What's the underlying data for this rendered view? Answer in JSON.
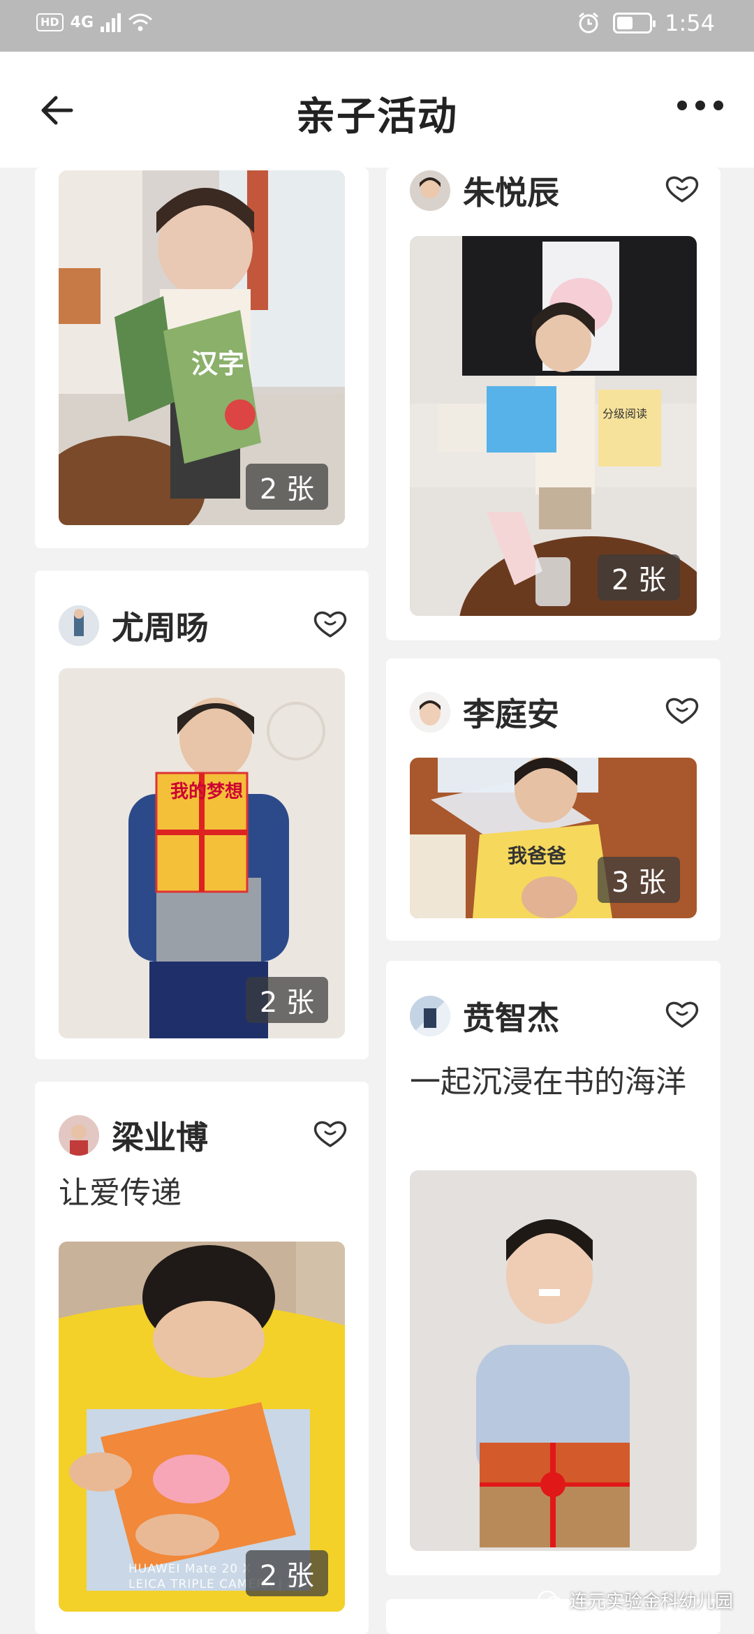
{
  "status_bar": {
    "network": "4G",
    "hd": "HD",
    "time": "1:54",
    "battery_level": 0.5
  },
  "header": {
    "title": "亲子活动"
  },
  "posts": [
    {
      "user": "",
      "count_badge": "2 张"
    },
    {
      "user": "朱悦辰",
      "count_badge": "2 张"
    },
    {
      "user": "尤周旸",
      "count_badge": "2 张"
    },
    {
      "user": "李庭安",
      "count_badge": "3 张"
    },
    {
      "user": "贲智杰",
      "caption": "一起沉浸在书的海洋"
    },
    {
      "user": "梁业博",
      "caption": "让爱传递",
      "count_badge": "2 张"
    }
  ],
  "book_titles": {
    "post1": "汉字",
    "post2": "分级阅读",
    "post3": "我的梦想",
    "post4": "我爸爸"
  },
  "camera_watermark": {
    "line1": "HUAWEI Mate 20 X",
    "line2": "LEICA TRIPLE CAMERA | AI"
  },
  "account_watermark": "连元实验金科幼儿园",
  "icons": {
    "back": "arrow-left-icon",
    "more": "more-dots-icon",
    "like": "heart-outline-icon",
    "wechat": "wechat-icon"
  },
  "colors": {
    "status_bar": "#b9b9b9",
    "background": "#f2f2f2",
    "card": "#ffffff"
  }
}
